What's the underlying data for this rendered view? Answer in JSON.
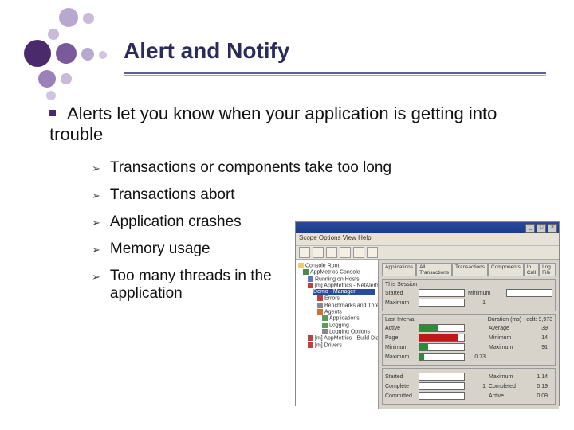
{
  "title": "Alert and Notify",
  "main_bullet": "Alerts let you know when your application is getting into trouble",
  "sub_bullets": [
    "Transactions or components take too long",
    "Transactions abort",
    "Application crashes",
    "Memory usage",
    "Too many threads in the application"
  ],
  "screenshot": {
    "menubar": "Scope   Options   View   Help",
    "tree": {
      "root": "Console Root",
      "n1": "AppMetrics Console",
      "n2": "Running on Hosts",
      "n3": "[m] AppMetrics - NetAlerts",
      "n4": "Demo - Manager",
      "n5": "Errors",
      "n6": "Benchmarks and Thresholds",
      "n7": "Agents",
      "n8": "Applications",
      "n9": "Logging",
      "n10": "Logging Options",
      "n11": "[m] AppMetrics - Build Diagnostics",
      "n12": "[m] Drivers"
    },
    "tabs": [
      "Applications",
      "All Transactions",
      "Transactions",
      "Components",
      "In Call",
      "Log File"
    ],
    "group1": {
      "title": "This Session",
      "rows": [
        {
          "label": "Started",
          "value": ""
        },
        {
          "label": "Minimum",
          "value": ""
        },
        {
          "label": "Maximum",
          "value": "1"
        }
      ]
    },
    "group2": {
      "title": "Last Interval",
      "extra": "Duration (ms) - edit: 9,973",
      "rows": [
        {
          "label": "Active",
          "fill_pct": 42,
          "fill_color": "#2e8b3d",
          "value": "",
          "r2": "Average",
          "rv": "39"
        },
        {
          "label": "Page",
          "fill_pct": 88,
          "fill_color": "#c01818",
          "value": "",
          "r2": "Minimum",
          "rv": "14"
        },
        {
          "label": "Minimum",
          "fill_pct": 20,
          "fill_color": "#2e8b3d",
          "value": "",
          "r2": "Maximum",
          "rv": "91"
        },
        {
          "label": "Maximum",
          "fill_pct": 10,
          "fill_color": "#2e8b3d",
          "value": "0.73",
          "r2": "",
          "rv": ""
        }
      ]
    },
    "group3": {
      "rows": [
        {
          "label": "Started",
          "value": "",
          "r2": "Maximum",
          "rv": "1.14"
        },
        {
          "label": "Complete",
          "value": "1",
          "r2": "Completed",
          "rv": "0.19"
        },
        {
          "label": "Committed",
          "value": "",
          "r2": "Active",
          "rv": "0.09"
        }
      ]
    }
  }
}
